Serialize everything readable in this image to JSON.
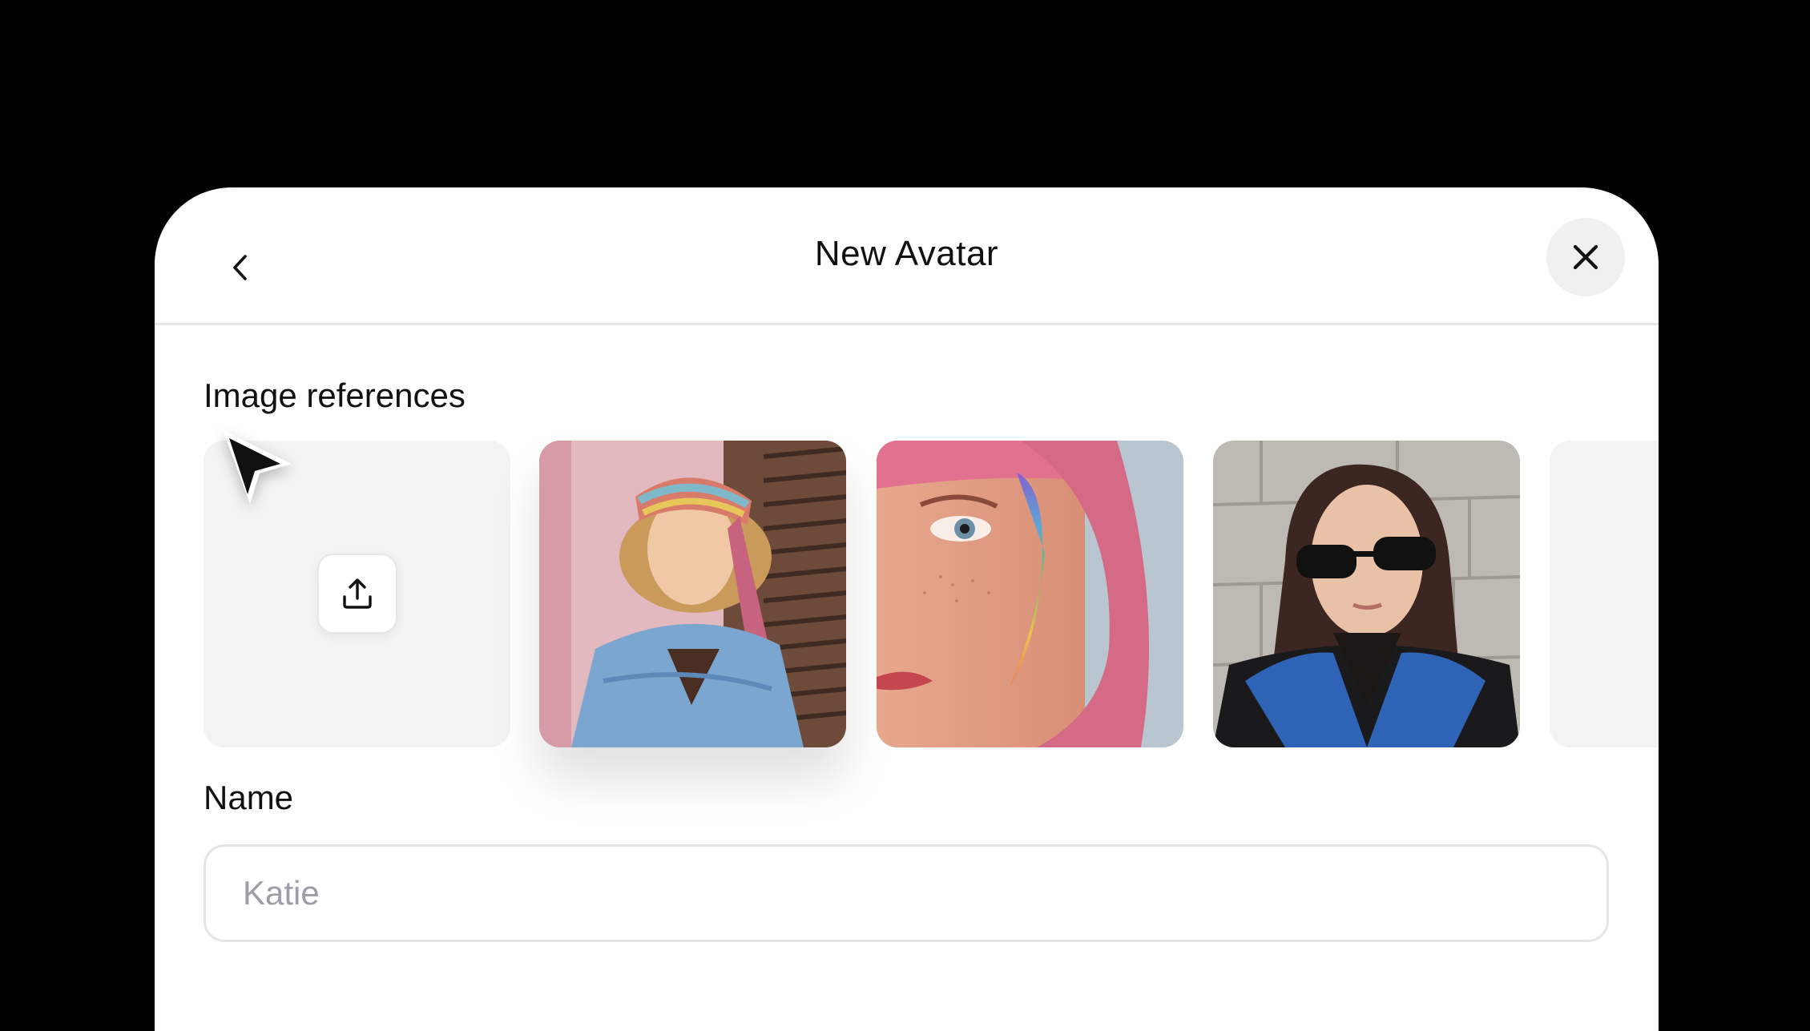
{
  "dialog": {
    "title": "New Avatar",
    "back_icon": "chevron-left-icon",
    "close_icon": "close-icon"
  },
  "image_references": {
    "label": "Image references",
    "upload_icon": "upload-icon",
    "images": [
      {
        "description": "woman-with-headscarf-denim-jacket"
      },
      {
        "description": "woman-pink-hair-rainbow-light"
      },
      {
        "description": "woman-sunglasses-blue-jacket"
      }
    ]
  },
  "name_field": {
    "label": "Name",
    "placeholder": "Katie",
    "value": ""
  },
  "colors": {
    "background": "#000000",
    "surface": "#ffffff",
    "tile_bg": "#f3f3f2",
    "placeholder": "#9a9ea6"
  }
}
